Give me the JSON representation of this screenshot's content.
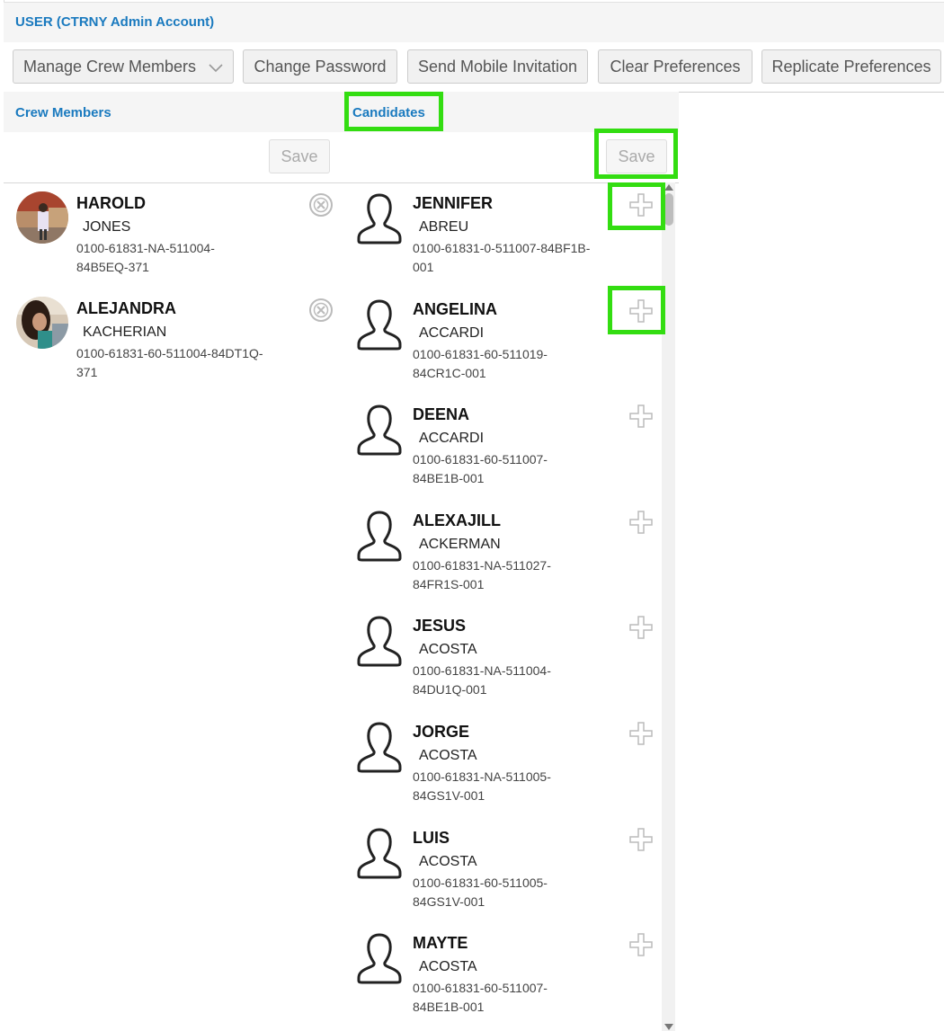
{
  "header": {
    "title": "USER (CTRNY Admin Account)"
  },
  "toolbar": {
    "manage": "Manage Crew Members",
    "change_password": "Change Password",
    "send_invite": "Send Mobile Invitation",
    "clear_prefs": "Clear Preferences",
    "replicate_prefs": "Replicate Preferences"
  },
  "tabs": {
    "crew": "Crew Members",
    "candidates": "Candidates"
  },
  "save_label": "Save",
  "crew_members": [
    {
      "first": "HAROLD",
      "last": "JONES",
      "code": "0100-61831-NA-511004-84B5EQ-371"
    },
    {
      "first": "ALEJANDRA",
      "last": "KACHERIAN",
      "code": "0100-61831-60-511004-84DT1Q-371"
    }
  ],
  "candidates": [
    {
      "first": "JENNIFER",
      "last": "ABREU",
      "code": "0100-61831-0-511007-84BF1B-001"
    },
    {
      "first": "ANGELINA",
      "last": "ACCARDI",
      "code": "0100-61831-60-511019-84CR1C-001"
    },
    {
      "first": "DEENA",
      "last": "ACCARDI",
      "code": "0100-61831-60-511007-84BE1B-001"
    },
    {
      "first": "ALEXAJILL",
      "last": "ACKERMAN",
      "code": "0100-61831-NA-511027-84FR1S-001"
    },
    {
      "first": "JESUS",
      "last": "ACOSTA",
      "code": "0100-61831-NA-511004-84DU1Q-001"
    },
    {
      "first": "JORGE",
      "last": "ACOSTA",
      "code": "0100-61831-NA-511005-84GS1V-001"
    },
    {
      "first": "LUIS",
      "last": "ACOSTA",
      "code": "0100-61831-60-511005-84GS1V-001"
    },
    {
      "first": "MAYTE",
      "last": "ACOSTA",
      "code": "0100-61831-60-511007-84BE1B-001"
    }
  ],
  "colors": {
    "accent": "#1a7abf",
    "highlight": "#33dd11"
  }
}
